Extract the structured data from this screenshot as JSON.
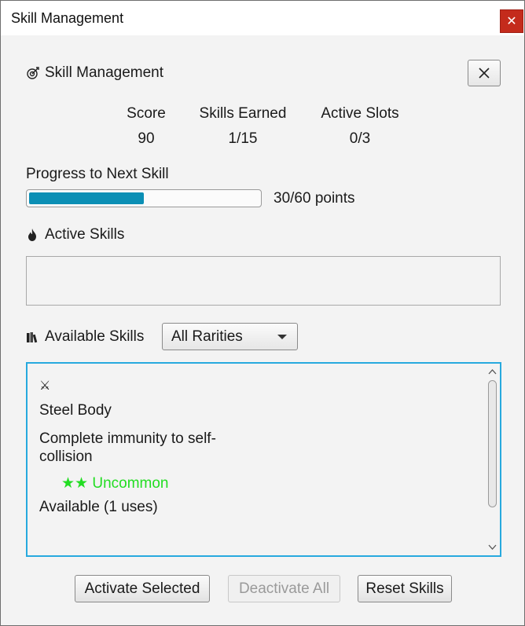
{
  "window": {
    "title": "Skill Management",
    "close_symbol": "✕"
  },
  "header": {
    "title": "Skill Management",
    "icon": "target-icon",
    "close_symbol": "✕"
  },
  "stats": [
    {
      "label": "Score",
      "value": "90"
    },
    {
      "label": "Skills Earned",
      "value": "1/15"
    },
    {
      "label": "Active Slots",
      "value": "0/3"
    }
  ],
  "progress": {
    "label": "Progress to Next Skill",
    "text": "30/60 points",
    "fraction": 0.5,
    "color": "#0b8fb5"
  },
  "active_skills": {
    "label": "Active Skills",
    "icon": "flame-icon"
  },
  "available_skills": {
    "label": "Available Skills",
    "icon": "books-icon",
    "filter": {
      "selected": "All Rarities"
    },
    "items": [
      {
        "symbol": "⚔",
        "name": "Steel Body",
        "description": "Complete immunity to self-collision",
        "rarity": "★★ Uncommon",
        "rarity_color": "#22dd22",
        "status": "Available (1 uses)"
      }
    ]
  },
  "buttons": {
    "activate": "Activate Selected",
    "deactivate": "Deactivate All",
    "reset": "Reset Skills"
  },
  "colors": {
    "accent": "#27a9de",
    "close_red": "#c42b1c"
  }
}
